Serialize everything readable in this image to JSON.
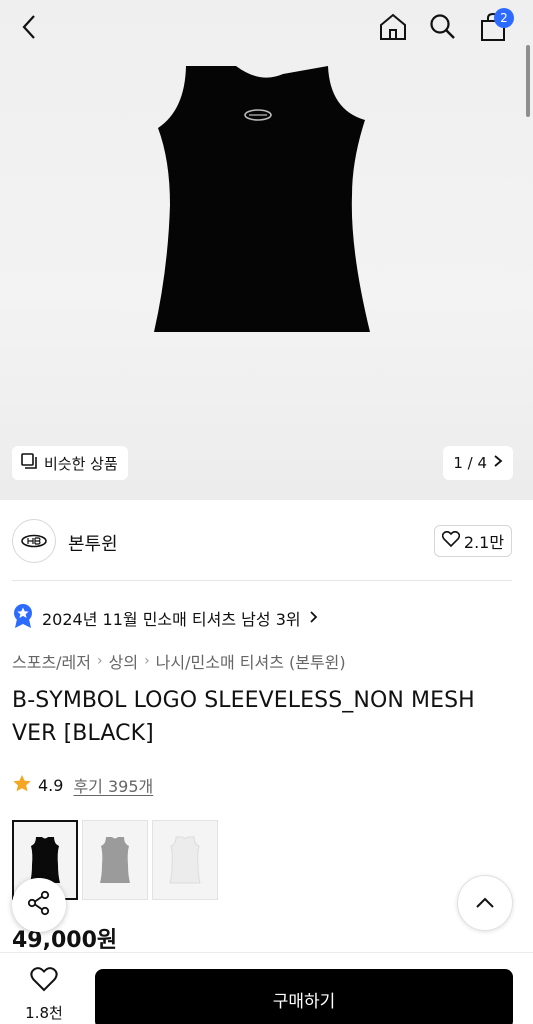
{
  "header": {
    "cart_count": "2"
  },
  "hero": {
    "similar_label": "비슷한 상품",
    "pager": "1 / 4"
  },
  "brand": {
    "name": "본투윈",
    "likes": "2.1만"
  },
  "ranking": {
    "text": "2024년 11월 민소매 티셔츠 남성 3위"
  },
  "breadcrumb": [
    "스포츠/레저",
    "상의",
    "나시/민소매 티셔츠 (본투윈)"
  ],
  "product": {
    "title": "B-SYMBOL LOGO SLEEVELESS_NON MESH VER [BLACK]",
    "rating": "4.9",
    "reviews": "후기 395개",
    "price": "49,000원"
  },
  "variants": [
    {
      "color": "#0a0a0a"
    },
    {
      "color": "#9b9b9b"
    },
    {
      "color": "#ececec"
    }
  ],
  "bottom": {
    "wish_count": "1.8천",
    "buy_label": "구매하기"
  },
  "colors": {
    "accent_blue": "#2d6bff",
    "star": "#f5a623",
    "primary_button": "#000000"
  }
}
